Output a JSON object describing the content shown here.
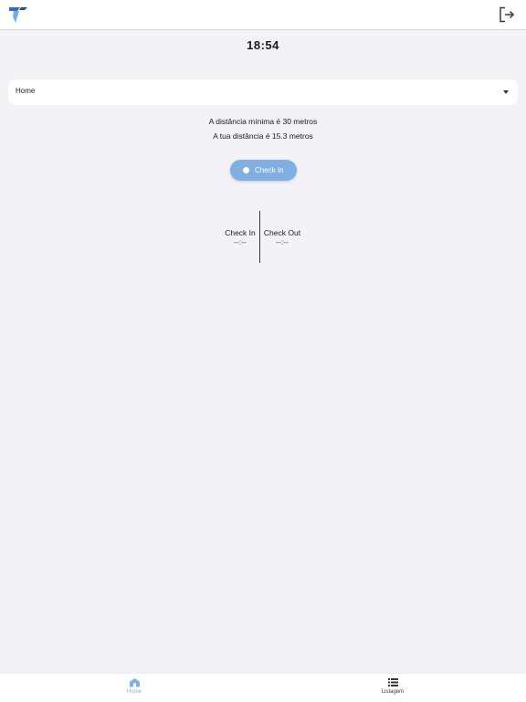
{
  "header": {
    "logo_icon": "brand-logo-icon",
    "logout_icon": "logout-icon"
  },
  "clock": {
    "time": "18:54"
  },
  "location_select": {
    "selected": "Home",
    "caret_icon": "chevron-down-icon"
  },
  "distance": {
    "minimum_text": "A distância mínima é 30 metros",
    "current_text": "A tua distância é 15.3 metros"
  },
  "checkin_button": {
    "label": "Check In",
    "icon": "dot-icon"
  },
  "stats": {
    "check_in": {
      "title": "Check In",
      "value": "--:--"
    },
    "check_out": {
      "title": "Check Out",
      "value": "--:--"
    }
  },
  "tabbar": {
    "items": [
      {
        "label": "Home",
        "icon": "home-icon"
      },
      {
        "label": "Listagem",
        "icon": "list-icon"
      }
    ]
  },
  "colors": {
    "accent": "#7fafe3",
    "background": "#f2f2f7",
    "surface": "#ffffff",
    "text": "#1c1c1e"
  }
}
